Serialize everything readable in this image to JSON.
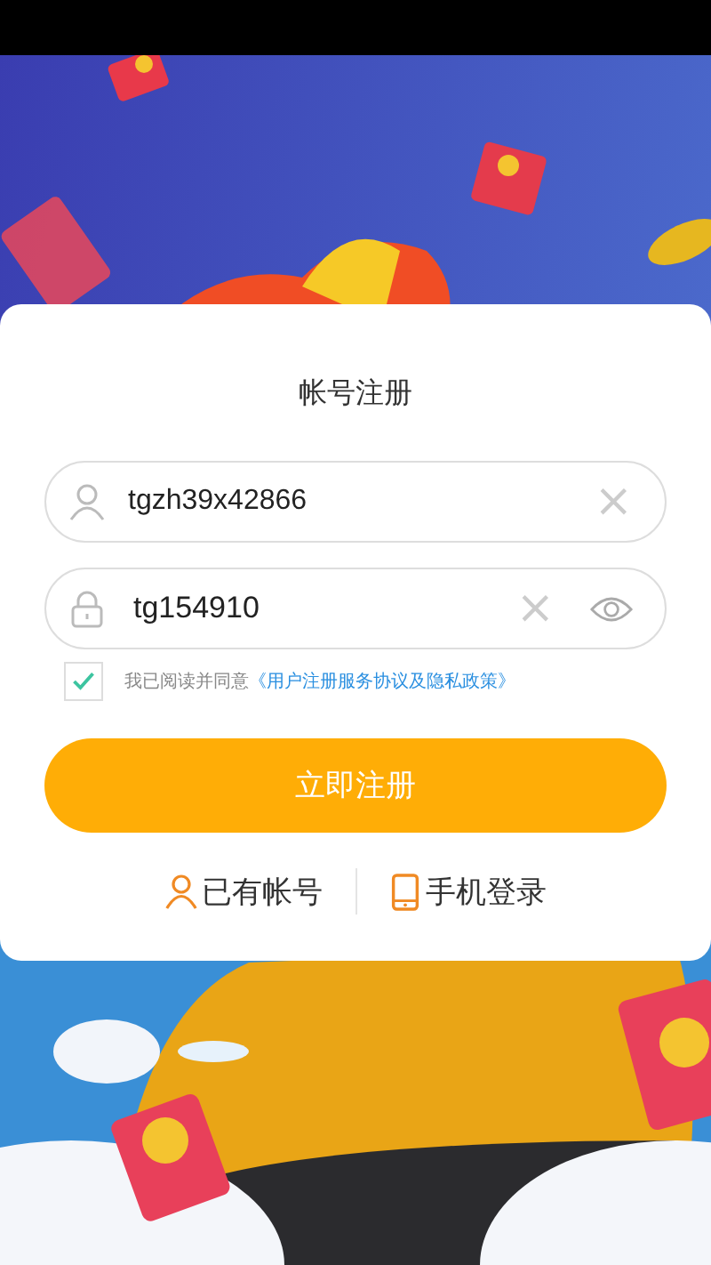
{
  "form": {
    "title": "帐号注册",
    "fields": [
      {
        "kind": "user",
        "value": "tgzh39x42866",
        "clear": "×"
      },
      {
        "kind": "password",
        "value": "tg154910",
        "clear": "×"
      }
    ],
    "agreement": {
      "checked": true,
      "text": "我已阅读并同意",
      "link": "《用户注册服务协议及隐私政策》"
    },
    "submit": "立即注册",
    "links": [
      {
        "kind": "account",
        "label": "已有帐号"
      },
      {
        "kind": "phone",
        "label": "手机登录"
      }
    ]
  }
}
